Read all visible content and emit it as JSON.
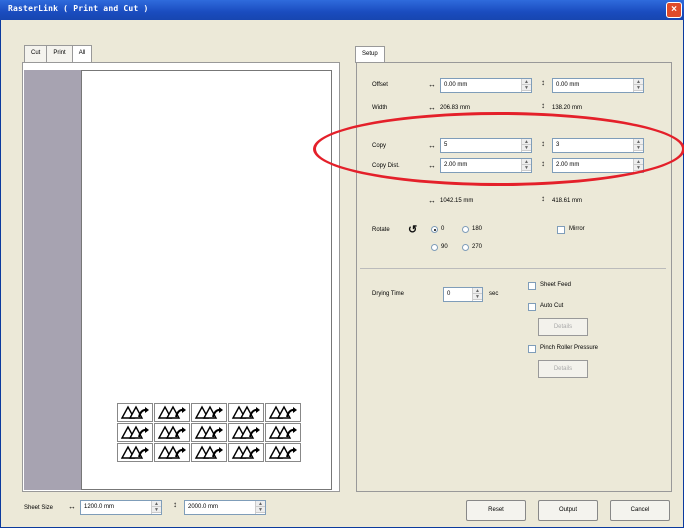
{
  "window": {
    "title": "RasterLink ( Print and Cut )",
    "close": "×"
  },
  "left_tabs": [
    "Cut",
    "Print",
    "All"
  ],
  "right_tab": "Setup",
  "setup": {
    "offset_label": "Offset",
    "offset_h": "0.00 mm",
    "offset_v": "0.00 mm",
    "width_label": "Width",
    "width_h": "206.83 mm",
    "width_v": "138.20 mm",
    "copy_label": "Copy",
    "copy_h": "5",
    "copy_v": "3",
    "copydist_label": "Copy Dist.",
    "copydist_h": "2.00 mm",
    "copydist_v": "2.00 mm",
    "total_h": "1042.15 mm",
    "total_v": "418.61 mm",
    "rotate_label": "Rotate",
    "rot_0": "0",
    "rot_180": "180",
    "rot_90": "90",
    "rot_270": "270",
    "mirror_label": "Mirror",
    "drying_label": "Drying Time",
    "drying_value": "0",
    "drying_unit": "sec",
    "sheet_feed": "Sheet Feed",
    "auto_cut": "Auto Cut",
    "details1": "Details",
    "pinch": "Pinch Roller Pressure",
    "details2": "Details"
  },
  "footer": {
    "sheet_size_label": "Sheet Size",
    "sheet_w": "1200.0 mm",
    "sheet_h": "2000.0 mm",
    "reset": "Reset",
    "output": "Output",
    "cancel": "Cancel"
  }
}
